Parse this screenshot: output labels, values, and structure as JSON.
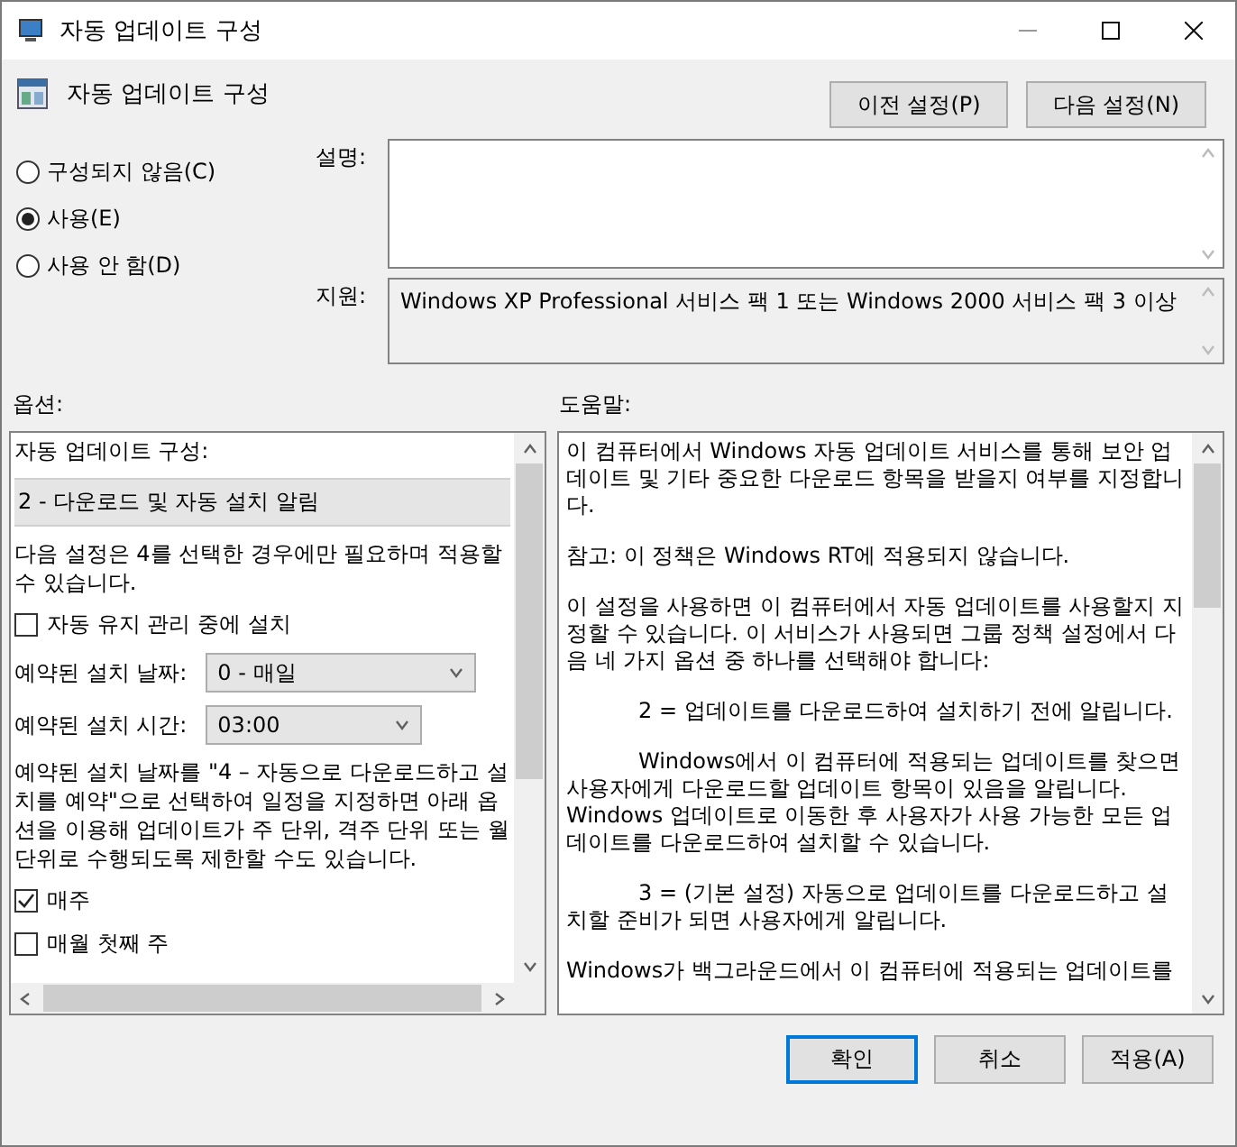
{
  "window": {
    "title": "자동 업데이트 구성"
  },
  "header": {
    "title": "자동 업데이트 구성"
  },
  "nav_buttons": [
    {
      "label": "이전 설정(P)"
    },
    {
      "label": "다음 설정(N)"
    }
  ],
  "state_options": [
    {
      "label": "구성되지 않음(C)",
      "selected": false
    },
    {
      "label": "사용(E)",
      "selected": true
    },
    {
      "label": "사용 안 함(D)",
      "selected": false
    }
  ],
  "description": {
    "label": "설명:"
  },
  "support": {
    "label": "지원:",
    "value": "Windows XP Professional 서비스 팩 1 또는 Windows 2000 서비스 팩 3 이상"
  },
  "options": {
    "label": "옵션:",
    "items": [
      {
        "kind": "label",
        "text": "자동 업데이트 구성:"
      },
      {
        "kind": "combo",
        "value": "2 - 다운로드 및 자동 설치 알림"
      },
      {
        "kind": "text",
        "text": "다음 설정은 4를 선택한 경우에만 필요하며 적용할 수 있습니다."
      },
      {
        "kind": "checkbox",
        "label": "자동 유지 관리 중에 설치",
        "checked": false
      },
      {
        "kind": "select",
        "label": "예약된 설치 날짜:",
        "value": "0 - 매일",
        "wide": true
      },
      {
        "kind": "select",
        "label": "예약된 설치 시간:",
        "value": "03:00",
        "wide": false
      },
      {
        "kind": "text",
        "text": "예약된 설치 날짜를 \"4 – 자동으로 다운로드하고 설치를 예약\"으로 선택하여 일정을 지정하면 아래 옵션을 이용해 업데이트가 주 단위, 격주 단위 또는 월 단위로 수행되도록 제한할 수도 있습니다."
      },
      {
        "kind": "checkbox",
        "label": "매주",
        "checked": true
      },
      {
        "kind": "checkbox",
        "label": "매월 첫째 주",
        "checked": false
      }
    ]
  },
  "help": {
    "label": "도움말:",
    "paragraphs": [
      {
        "text": "이 컴퓨터에서 Windows 자동 업데이트 서비스를 통해 보안 업데이트 및 기타 중요한 다운로드 항목을 받을지 여부를 지정합니다.",
        "indented": false
      },
      {
        "text": "참고: 이 정책은 Windows RT에 적용되지 않습니다.",
        "indented": false
      },
      {
        "text": "이 설정을 사용하면 이 컴퓨터에서 자동 업데이트를 사용할지 지정할 수 있습니다. 이 서비스가 사용되면 그룹 정책 설정에서 다음 네 가지 옵션 중 하나를 선택해야 합니다:",
        "indented": false
      },
      {
        "text": "2 = 업데이트를 다운로드하여 설치하기 전에 알립니다.",
        "indented": true
      },
      {
        "text": "Windows에서 이 컴퓨터에 적용되는 업데이트를 찾으면 사용자에게 다운로드할 업데이트 항목이 있음을 알립니다. Windows 업데이트로 이동한 후 사용자가 사용 가능한 모든 업데이트를 다운로드하여 설치할 수 있습니다.",
        "indented": true
      },
      {
        "text": "3 = (기본 설정) 자동으로 업데이트를 다운로드하고 설치할 준비가 되면 사용자에게 알립니다.",
        "indented": true
      },
      {
        "text": "Windows가 백그라운드에서 이 컴퓨터에 적용되는 업데이트를",
        "indented": false
      }
    ]
  },
  "buttons": [
    {
      "label": "확인",
      "default": true
    },
    {
      "label": "취소",
      "default": false
    },
    {
      "label": "적용(A)",
      "default": false
    }
  ]
}
